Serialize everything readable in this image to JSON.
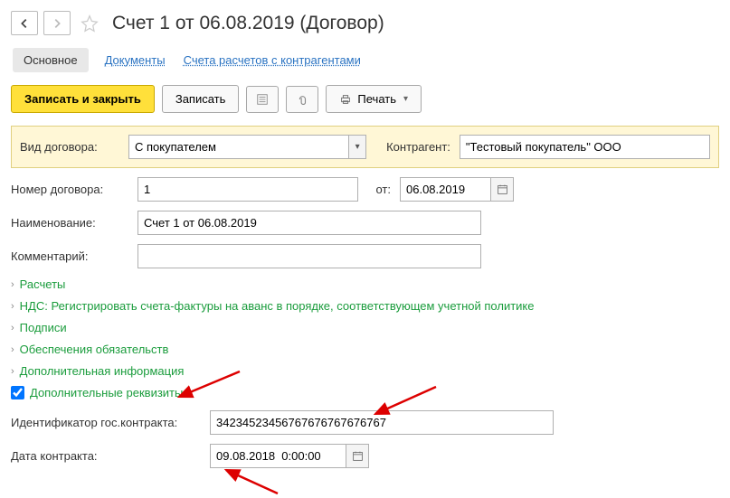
{
  "header": {
    "title": "Счет 1 от 06.08.2019 (Договор)"
  },
  "tabs": {
    "main": "Основное",
    "docs": "Документы",
    "accounts": "Счета расчетов с контрагентами"
  },
  "toolbar": {
    "save_close": "Записать и закрыть",
    "save": "Записать",
    "print": "Печать"
  },
  "form": {
    "contract_type_label": "Вид договора:",
    "contract_type_value": "С покупателем",
    "contragent_label": "Контрагент:",
    "contragent_value": "\"Тестовый покупатель\" ООО",
    "number_label": "Номер договора:",
    "number_value": "1",
    "from_label": "от:",
    "from_date": "06.08.2019",
    "name_label": "Наименование:",
    "name_value": "Счет 1 от 06.08.2019",
    "comment_label": "Комментарий:",
    "comment_value": ""
  },
  "expanders": {
    "calc": "Расчеты",
    "nds": "НДС: Регистрировать счета-фактуры на аванс в порядке, соответствующем учетной политике",
    "sign": "Подписи",
    "secure": "Обеспечения обязательств",
    "extra": "Дополнительная информация"
  },
  "extra_req": {
    "checkbox_label": "Дополнительные реквизиты",
    "gos_id_label": "Идентификатор гос.контракта:",
    "gos_id_value": "34234523456767676767676767",
    "date_label": "Дата контракта:",
    "date_value": "09.08.2018  0:00:00"
  }
}
